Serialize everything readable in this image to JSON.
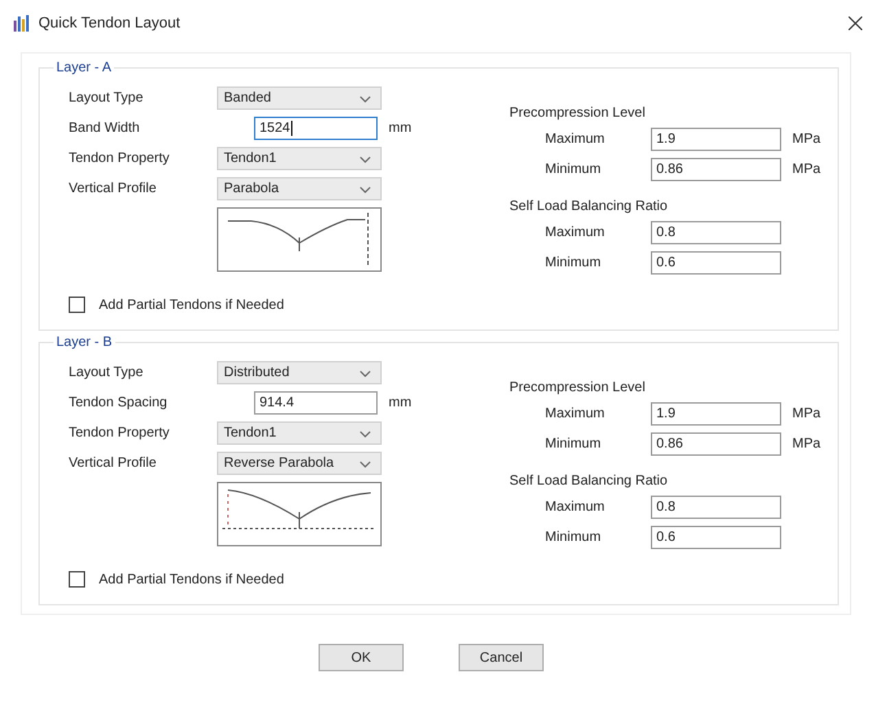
{
  "window": {
    "title": "Quick Tendon Layout"
  },
  "layers": [
    {
      "title": "Layer - A",
      "layout_type": {
        "label": "Layout Type",
        "value": "Banded"
      },
      "spacing": {
        "label": "Band Width",
        "value": "1524",
        "unit": "mm",
        "focused": true
      },
      "tendon_property": {
        "label": "Tendon Property",
        "value": "Tendon1"
      },
      "vertical_profile": {
        "label": "Vertical Profile",
        "value": "Parabola"
      },
      "profile_preview": {
        "kind": "parabola"
      },
      "partial_tendons": {
        "label": "Add Partial Tendons if Needed",
        "checked": false
      },
      "precompression": {
        "title": "Precompression Level",
        "maximum": {
          "label": "Maximum",
          "value": "1.9",
          "unit": "MPa"
        },
        "minimum": {
          "label": "Minimum",
          "value": "0.86",
          "unit": "MPa"
        }
      },
      "balancing": {
        "title": "Self Load Balancing Ratio",
        "maximum": {
          "label": "Maximum",
          "value": "0.8"
        },
        "minimum": {
          "label": "Minimum",
          "value": "0.6"
        }
      }
    },
    {
      "title": "Layer - B",
      "layout_type": {
        "label": "Layout Type",
        "value": "Distributed"
      },
      "spacing": {
        "label": "Tendon Spacing",
        "value": "914.4",
        "unit": "mm",
        "focused": false
      },
      "tendon_property": {
        "label": "Tendon Property",
        "value": "Tendon1"
      },
      "vertical_profile": {
        "label": "Vertical Profile",
        "value": "Reverse Parabola"
      },
      "profile_preview": {
        "kind": "reverse-parabola"
      },
      "partial_tendons": {
        "label": "Add Partial Tendons if Needed",
        "checked": false
      },
      "precompression": {
        "title": "Precompression Level",
        "maximum": {
          "label": "Maximum",
          "value": "1.9",
          "unit": "MPa"
        },
        "minimum": {
          "label": "Minimum",
          "value": "0.86",
          "unit": "MPa"
        }
      },
      "balancing": {
        "title": "Self Load Balancing Ratio",
        "maximum": {
          "label": "Maximum",
          "value": "0.8"
        },
        "minimum": {
          "label": "Minimum",
          "value": "0.6"
        }
      }
    }
  ],
  "buttons": [
    "OK",
    "Cancel"
  ]
}
